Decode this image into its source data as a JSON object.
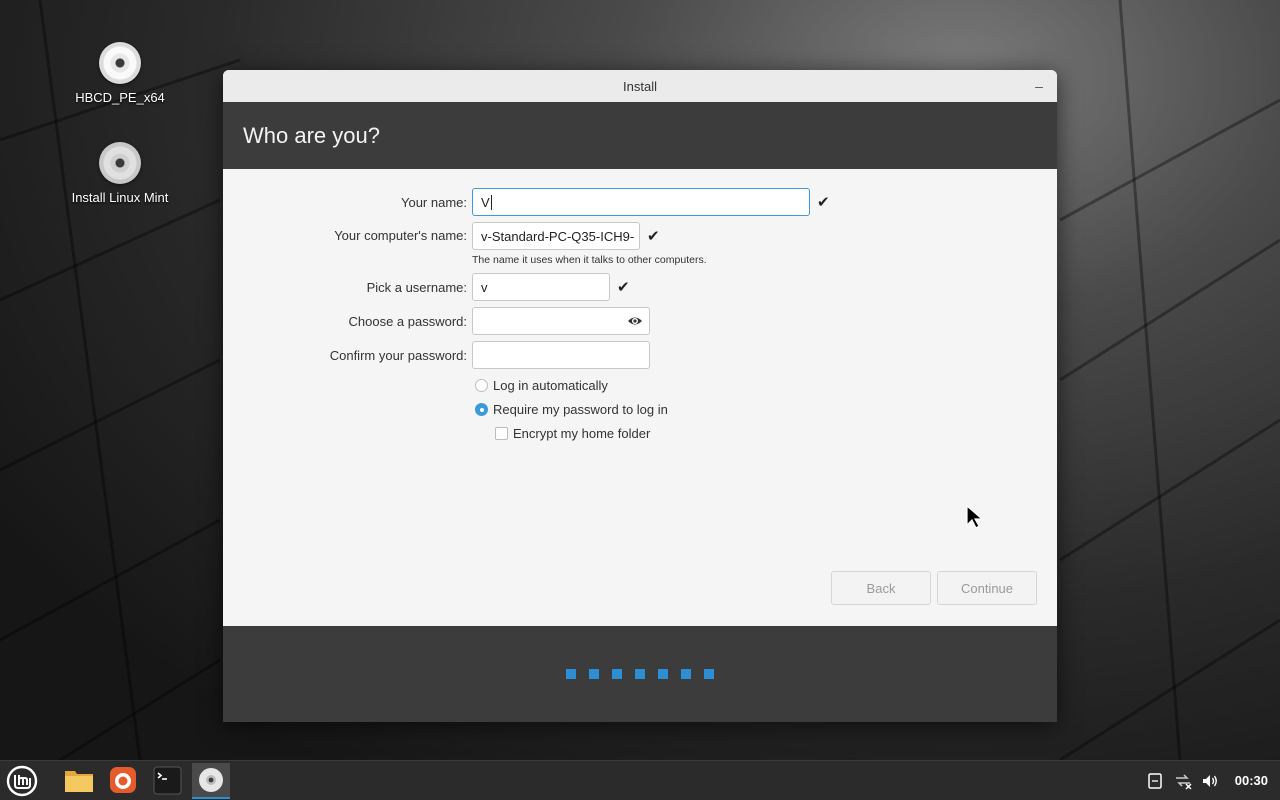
{
  "desktop": {
    "icons": [
      {
        "label": "HBCD_PE_x64",
        "icon": "disc-icon"
      },
      {
        "label": "Install Linux Mint",
        "icon": "disc-icon"
      }
    ]
  },
  "window": {
    "title": "Install",
    "minimize_label": "–",
    "header": "Who are you?"
  },
  "form": {
    "name_label": "Your name:",
    "name_value": "V",
    "computer_label": "Your computer's name:",
    "computer_value": "v-Standard-PC-Q35-ICH9-",
    "computer_hint": "The name it uses when it talks to other computers.",
    "username_label": "Pick a username:",
    "username_value": "v",
    "password_label": "Choose a password:",
    "password_value": "",
    "confirm_label": "Confirm your password:",
    "confirm_value": "",
    "check_mark": "✔",
    "login_auto_label": "Log in automatically",
    "login_auto_selected": false,
    "require_password_label": "Require my password to log in",
    "require_password_selected": true,
    "encrypt_label": "Encrypt my home folder",
    "encrypt_checked": false
  },
  "buttons": {
    "back": "Back",
    "continue": "Continue"
  },
  "progress": {
    "total_steps": 7,
    "accent": "#2d8fd3"
  },
  "taskbar": {
    "items": [
      "mint-menu-icon",
      "files-icon",
      "firefox-icon",
      "terminal-icon",
      "installer-disc-icon"
    ],
    "tray": [
      "notes-icon",
      "network-disconnected-icon",
      "volume-icon"
    ],
    "clock": "00:30"
  }
}
